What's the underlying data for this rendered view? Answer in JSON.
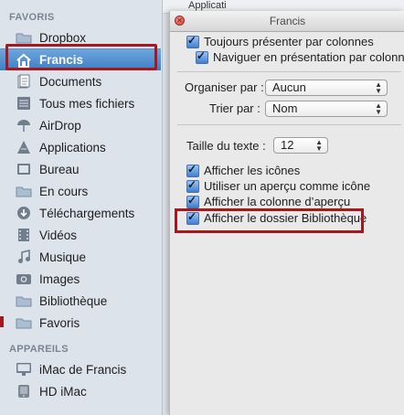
{
  "sidebar": {
    "favorites_title": "FAVORIS",
    "devices_title": "APPAREILS",
    "favorites": [
      {
        "label": "Dropbox",
        "icon": "folder-icon"
      },
      {
        "label": "Francis",
        "icon": "home-icon"
      },
      {
        "label": "Documents",
        "icon": "documents-icon"
      },
      {
        "label": "Tous mes fichiers",
        "icon": "all-files-icon"
      },
      {
        "label": "AirDrop",
        "icon": "airdrop-icon"
      },
      {
        "label": "Applications",
        "icon": "applications-icon"
      },
      {
        "label": "Bureau",
        "icon": "desktop-icon"
      },
      {
        "label": "En cours",
        "icon": "folder-icon"
      },
      {
        "label": "Téléchargements",
        "icon": "downloads-icon"
      },
      {
        "label": "Vidéos",
        "icon": "movies-icon"
      },
      {
        "label": "Musique",
        "icon": "music-icon"
      },
      {
        "label": "Images",
        "icon": "pictures-icon"
      },
      {
        "label": "Bibliothèque",
        "icon": "folder-icon"
      },
      {
        "label": "Favoris",
        "icon": "folder-icon"
      }
    ],
    "devices": [
      {
        "label": "iMac de Francis",
        "icon": "imac-icon"
      },
      {
        "label": "HD iMac",
        "icon": "hard-drive-icon"
      }
    ],
    "selected": "Francis"
  },
  "panel": {
    "title": "Francis",
    "background_tab_text": "Applicati",
    "always_columns": "Toujours présenter par colonnes",
    "browse_columns": "Naviguer en présentation par colonnes",
    "arrange_label": "Organiser par :",
    "arrange_value": "Aucun",
    "sort_label": "Trier par :",
    "sort_value": "Nom",
    "text_size_label": "Taille du texte :",
    "text_size_value": "12",
    "show_icons": "Afficher les icônes",
    "icon_preview": "Utiliser un aperçu comme icône",
    "preview_column": "Afficher la colonne d’aperçu",
    "show_library": "Afficher le dossier Bibliothèque"
  },
  "colors": {
    "highlight_red": "#a4191d",
    "selection_blue": "#3c7fc6"
  }
}
